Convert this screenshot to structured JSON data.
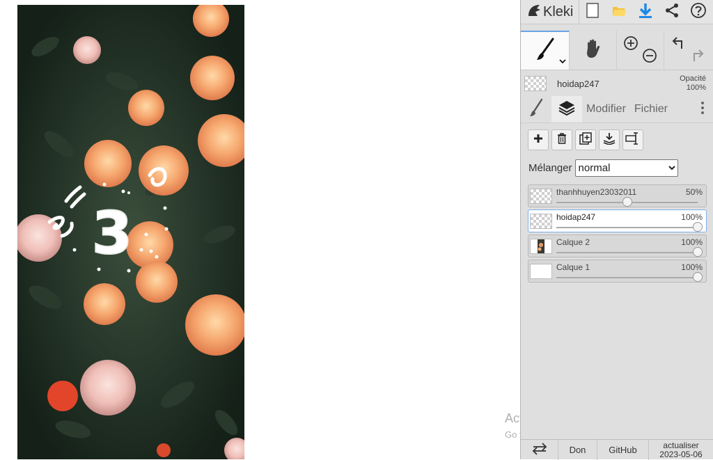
{
  "app": {
    "name": "Kleki"
  },
  "artwork": {
    "countdown_number": "3"
  },
  "watermark": {
    "title": "Activate Windows",
    "subtitle": "Go to Settings to activate Windows."
  },
  "current_layer": {
    "name": "hoidap247",
    "opacity_label": "Opacité",
    "opacity_value": "100%"
  },
  "tabs": {
    "modifier": "Modifier",
    "fichier": "Fichier"
  },
  "blend": {
    "label": "Mélanger",
    "value": "normal"
  },
  "layers": [
    {
      "name": "thanhhuyen23032011",
      "opacity": "50%",
      "opacity_fraction": 0.5,
      "selected": false,
      "thumb": "transparent"
    },
    {
      "name": "hoidap247",
      "opacity": "100%",
      "opacity_fraction": 1.0,
      "selected": true,
      "thumb": "transparent"
    },
    {
      "name": "Calque 2",
      "opacity": "100%",
      "opacity_fraction": 1.0,
      "selected": false,
      "thumb": "photo"
    },
    {
      "name": "Calque 1",
      "opacity": "100%",
      "opacity_fraction": 1.0,
      "selected": false,
      "thumb": "white"
    }
  ],
  "bottom": {
    "don": "Don",
    "github": "GitHub",
    "update_label": "actualiser",
    "update_date": "2023-05-06"
  },
  "colors": {
    "accent_blue": "#1e88e5",
    "folder_yellow": "#f5c23a",
    "selected_border": "#7fb0ea",
    "sidebar_bg": "#dfdfdf"
  },
  "icons": {
    "logo": "kleki-logo-icon",
    "new": "new-image-icon",
    "open": "folder-icon",
    "save": "download-icon",
    "share": "share-icon",
    "help": "help-icon",
    "brush": "brush-icon",
    "hand": "hand-icon",
    "zoom_in": "zoom-in-icon",
    "zoom_out": "zoom-out-icon",
    "undo": "undo-icon",
    "redo": "redo-icon",
    "add": "plus-icon",
    "delete": "trash-icon",
    "duplicate": "duplicate-icon",
    "merge": "merge-down-icon",
    "rename": "rename-icon",
    "layers": "layers-icon",
    "more": "more-vertical-icon",
    "swap": "swap-arrows-icon"
  }
}
